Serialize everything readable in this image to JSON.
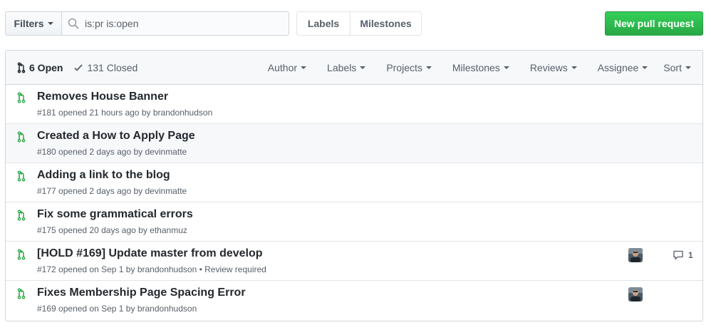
{
  "toolbar": {
    "filters_label": "Filters",
    "search_value": "is:pr is:open",
    "labels_label": "Labels",
    "milestones_label": "Milestones",
    "new_pr_label": "New pull request"
  },
  "colors": {
    "accent_green": "#28a745",
    "pr_icon_green": "#28a745",
    "text": "#24292e",
    "muted": "#586069"
  },
  "header": {
    "open_label": "6 Open",
    "closed_label": "131 Closed",
    "filters": [
      "Author",
      "Labels",
      "Projects",
      "Milestones",
      "Reviews",
      "Assignee",
      "Sort"
    ]
  },
  "pull_requests": [
    {
      "title": "Removes House Banner",
      "number": "#181",
      "opened": "opened 21 hours ago by",
      "author": "brandonhudson",
      "extra": "",
      "has_avatar": false,
      "comments": ""
    },
    {
      "title": "Created a How to Apply Page",
      "number": "#180",
      "opened": "opened 2 days ago by",
      "author": "devinmatte",
      "extra": "",
      "has_avatar": false,
      "comments": ""
    },
    {
      "title": "Adding a link to the blog",
      "number": "#177",
      "opened": "opened 2 days ago by",
      "author": "devinmatte",
      "extra": "",
      "has_avatar": false,
      "comments": ""
    },
    {
      "title": "Fix some grammatical errors",
      "number": "#175",
      "opened": "opened 20 days ago by",
      "author": "ethanmuz",
      "extra": "",
      "has_avatar": false,
      "comments": ""
    },
    {
      "title": "[HOLD #169] Update master from develop",
      "number": "#172",
      "opened": "opened on Sep 1 by",
      "author": "brandonhudson",
      "extra": "• Review required",
      "has_avatar": true,
      "comments": "1"
    },
    {
      "title": "Fixes Membership Page Spacing Error",
      "number": "#169",
      "opened": "opened on Sep 1 by",
      "author": "brandonhudson",
      "extra": "",
      "has_avatar": true,
      "comments": ""
    }
  ]
}
